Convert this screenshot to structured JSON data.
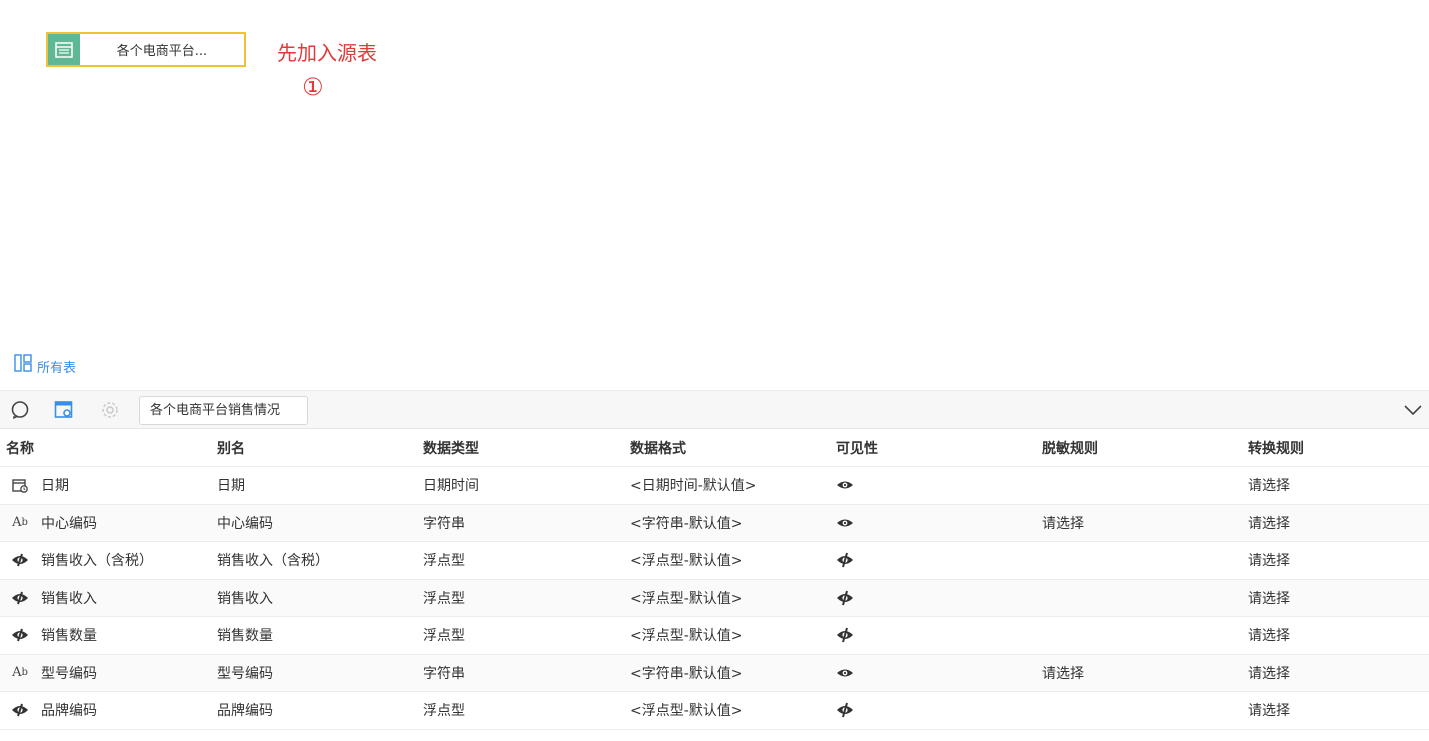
{
  "canvas": {
    "node_label": "各个电商平台...",
    "annotation_text": "先加入源表",
    "annotation_number": "①"
  },
  "all_tables_label": "所有表",
  "toolbar": {
    "tab_label": "各个电商平台销售情况",
    "icons": [
      "preview-icon",
      "table-settings-icon",
      "gear-icon",
      "chevron-down-icon"
    ]
  },
  "columns": [
    "名称",
    "别名",
    "数据类型",
    "数据格式",
    "可见性",
    "脱敏规则",
    "转换规则"
  ],
  "rows": [
    {
      "type_icon": "datetime",
      "name": "日期",
      "alias": "日期",
      "data_type": "日期时间",
      "format": "<日期时间-默认值>",
      "visibility": "visible",
      "mask": "",
      "transform": "请选择"
    },
    {
      "type_icon": "string",
      "name": "中心编码",
      "alias": "中心编码",
      "data_type": "字符串",
      "format": "<字符串-默认值>",
      "visibility": "visible",
      "mask": "请选择",
      "transform": "请选择"
    },
    {
      "type_icon": "float",
      "name": "销售收入（含税）",
      "alias": "销售收入（含税）",
      "data_type": "浮点型",
      "format": "<浮点型-默认值>",
      "visibility": "visible",
      "mask": "",
      "transform": "请选择"
    },
    {
      "type_icon": "float",
      "name": "销售收入",
      "alias": "销售收入",
      "data_type": "浮点型",
      "format": "<浮点型-默认值>",
      "visibility": "visible",
      "mask": "",
      "transform": "请选择"
    },
    {
      "type_icon": "float",
      "name": "销售数量",
      "alias": "销售数量",
      "data_type": "浮点型",
      "format": "<浮点型-默认值>",
      "visibility": "visible",
      "mask": "",
      "transform": "请选择"
    },
    {
      "type_icon": "string",
      "name": "型号编码",
      "alias": "型号编码",
      "data_type": "字符串",
      "format": "<字符串-默认值>",
      "visibility": "visible",
      "mask": "请选择",
      "transform": "请选择"
    },
    {
      "type_icon": "float",
      "name": "品牌编码",
      "alias": "品牌编码",
      "data_type": "浮点型",
      "format": "<浮点型-默认值>",
      "visibility": "visible",
      "mask": "",
      "transform": "请选择"
    }
  ],
  "colors": {
    "accent": "#3a8ee6",
    "annotation": "#e03a3a",
    "node_border": "#f0c23a",
    "node_icon": "#5fb894"
  }
}
